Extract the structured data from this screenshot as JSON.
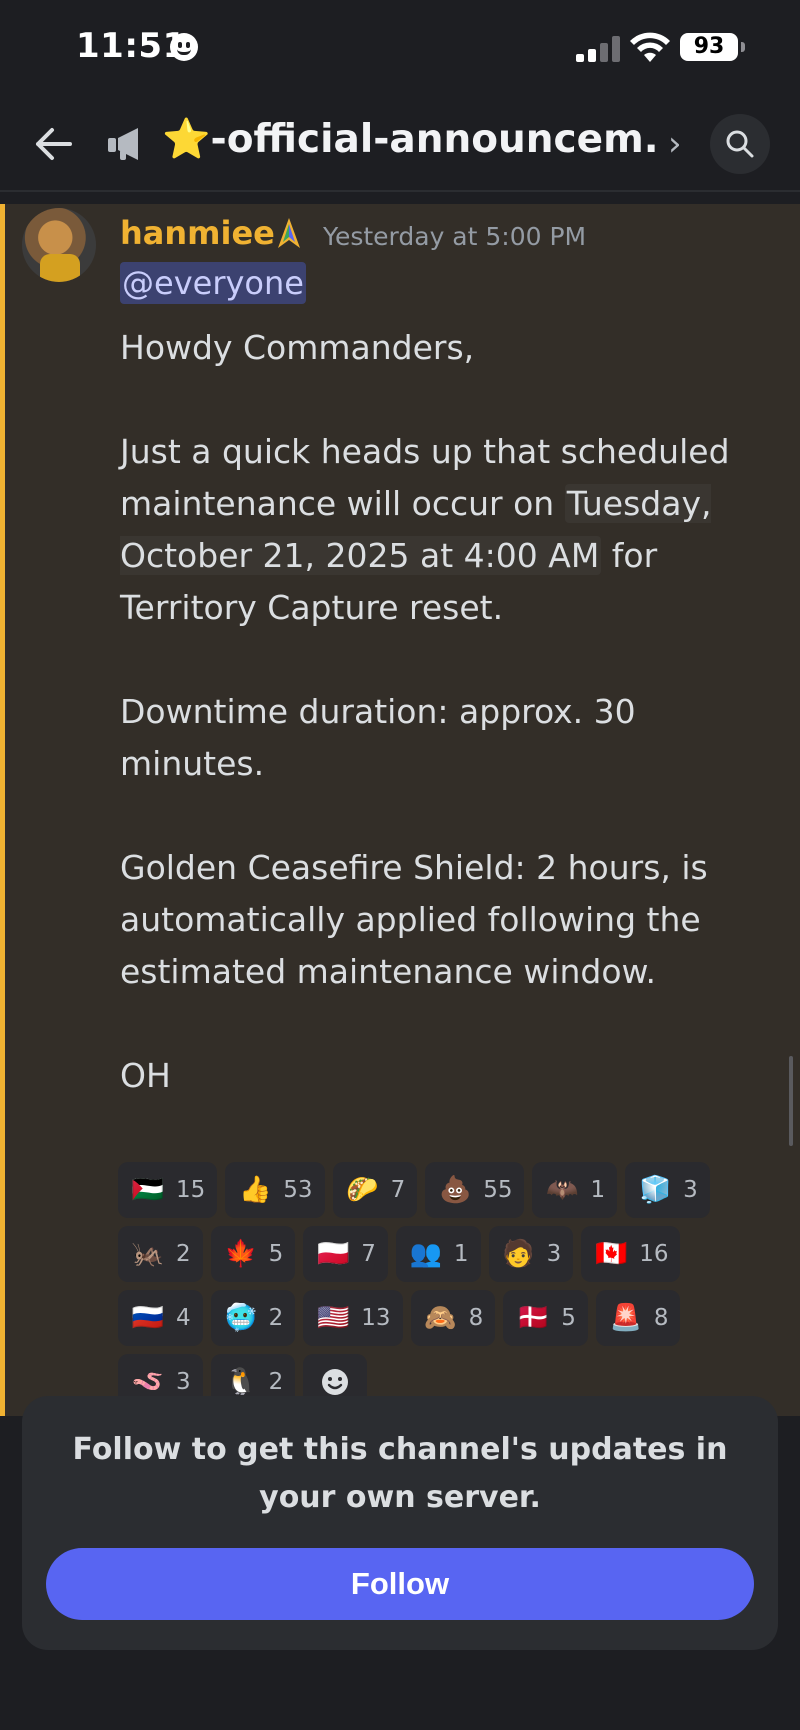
{
  "status_bar": {
    "time": "11:51",
    "battery": "93"
  },
  "header": {
    "back_icon": "back-arrow-icon",
    "channel_icon": "megaphone-icon",
    "title": "⭐-official-announcem...",
    "chevron": "›",
    "search_icon": "search-icon"
  },
  "message": {
    "author": "hanmiee",
    "timestamp": "Yesterday at 5:00 PM",
    "mention": "@everyone",
    "greeting": "Howdy Commanders,",
    "para1_before": "Just a quick heads up that scheduled maintenance will occur on ",
    "para1_date": "Tuesday, October 21, 2025 at 4:00 AM",
    "para1_after": " for Territory Capture reset.",
    "para2": "Downtime duration: approx. 30 minutes.",
    "para3": "Golden Ceasefire Shield:  2 hours, is automatically applied following the estimated maintenance window.",
    "signoff": "OH"
  },
  "reactions": [
    {
      "emoji": "🇵🇸",
      "count": "15"
    },
    {
      "emoji": "👍",
      "count": "53"
    },
    {
      "emoji": "🌮",
      "count": "7"
    },
    {
      "emoji": "💩",
      "count": "55"
    },
    {
      "emoji": "🦇",
      "count": "1"
    },
    {
      "emoji": "🧊",
      "count": "3"
    },
    {
      "emoji": "🦗",
      "count": "2"
    },
    {
      "emoji": "🍁",
      "count": "5"
    },
    {
      "emoji": "🇵🇱",
      "count": "7"
    },
    {
      "emoji": "👥",
      "count": "1"
    },
    {
      "emoji": "🧑",
      "count": "3"
    },
    {
      "emoji": "🇨🇦",
      "count": "16"
    },
    {
      "emoji": "🇷🇺",
      "count": "4"
    },
    {
      "emoji": "🥶",
      "count": "2"
    },
    {
      "emoji": "🇺🇸",
      "count": "13"
    },
    {
      "emoji": "🙈",
      "count": "8"
    },
    {
      "emoji": "🇩🇰",
      "count": "5"
    },
    {
      "emoji": "🚨",
      "count": "8"
    },
    {
      "emoji": "🪱",
      "count": "3"
    },
    {
      "emoji": "🐧",
      "count": "2"
    }
  ],
  "follow_card": {
    "text": "Follow to get this channel's updates in your own server.",
    "button": "Follow"
  },
  "colors": {
    "accent": "#5865f2",
    "mention_bar": "#f0b232",
    "author": "#f0b232"
  }
}
